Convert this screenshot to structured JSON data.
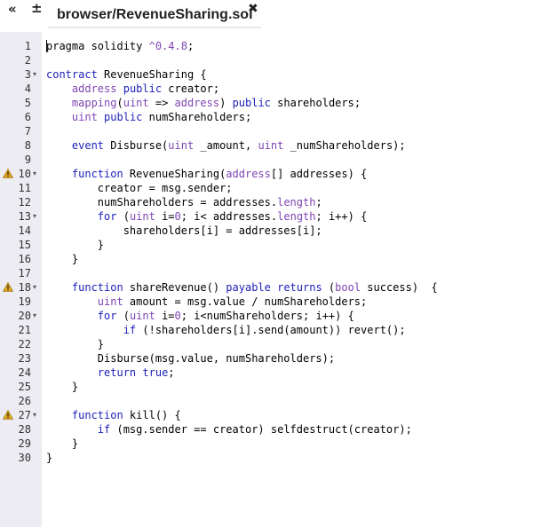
{
  "tabbar": {
    "nav_left": "«",
    "nav_right": "±",
    "tab_title": "browser/RevenueSharing.sol",
    "close_glyph": "✖"
  },
  "icons": {
    "warning_color": "#e3a418",
    "fold_marker": "▾"
  },
  "editor": {
    "lines": [
      {
        "n": "1",
        "fold": false,
        "warn": false,
        "tokens": [
          [
            "t",
            "pragma solidity "
          ],
          [
            "lit",
            "^0.4.8"
          ],
          [
            "t",
            ";"
          ]
        ]
      },
      {
        "n": "2",
        "fold": false,
        "warn": false,
        "tokens": []
      },
      {
        "n": "3",
        "fold": true,
        "warn": false,
        "tokens": [
          [
            "kw",
            "contract"
          ],
          [
            "t",
            " RevenueSharing {"
          ]
        ]
      },
      {
        "n": "4",
        "fold": false,
        "warn": false,
        "tokens": [
          [
            "t",
            "    "
          ],
          [
            "ty",
            "address"
          ],
          [
            "t",
            " "
          ],
          [
            "kw",
            "public"
          ],
          [
            "t",
            " creator;"
          ]
        ]
      },
      {
        "n": "5",
        "fold": false,
        "warn": false,
        "tokens": [
          [
            "t",
            "    "
          ],
          [
            "ty",
            "mapping"
          ],
          [
            "t",
            "("
          ],
          [
            "ty",
            "uint"
          ],
          [
            "t",
            " => "
          ],
          [
            "ty",
            "address"
          ],
          [
            "t",
            ") "
          ],
          [
            "kw",
            "public"
          ],
          [
            "t",
            " shareholders;"
          ]
        ]
      },
      {
        "n": "6",
        "fold": false,
        "warn": false,
        "tokens": [
          [
            "t",
            "    "
          ],
          [
            "ty",
            "uint"
          ],
          [
            "t",
            " "
          ],
          [
            "kw",
            "public"
          ],
          [
            "t",
            " numShareholders;"
          ]
        ]
      },
      {
        "n": "7",
        "fold": false,
        "warn": false,
        "tokens": []
      },
      {
        "n": "8",
        "fold": false,
        "warn": false,
        "tokens": [
          [
            "t",
            "    "
          ],
          [
            "kw",
            "event"
          ],
          [
            "t",
            " Disburse("
          ],
          [
            "ty",
            "uint"
          ],
          [
            "t",
            " _amount, "
          ],
          [
            "ty",
            "uint"
          ],
          [
            "t",
            " _numShareholders);"
          ]
        ]
      },
      {
        "n": "9",
        "fold": false,
        "warn": false,
        "tokens": []
      },
      {
        "n": "10",
        "fold": true,
        "warn": true,
        "tokens": [
          [
            "t",
            "    "
          ],
          [
            "kw",
            "function"
          ],
          [
            "t",
            " RevenueSharing("
          ],
          [
            "ty",
            "address"
          ],
          [
            "t",
            "[] addresses) {"
          ]
        ]
      },
      {
        "n": "11",
        "fold": false,
        "warn": false,
        "tokens": [
          [
            "t",
            "        creator = msg.sender;"
          ]
        ]
      },
      {
        "n": "12",
        "fold": false,
        "warn": false,
        "tokens": [
          [
            "t",
            "        numShareholders = addresses."
          ],
          [
            "ty",
            "length"
          ],
          [
            "t",
            ";"
          ]
        ]
      },
      {
        "n": "13",
        "fold": true,
        "warn": false,
        "tokens": [
          [
            "t",
            "        "
          ],
          [
            "kw",
            "for"
          ],
          [
            "t",
            " ("
          ],
          [
            "ty",
            "uint"
          ],
          [
            "t",
            " i="
          ],
          [
            "lit",
            "0"
          ],
          [
            "t",
            "; i< addresses."
          ],
          [
            "ty",
            "length"
          ],
          [
            "t",
            "; i++) {"
          ]
        ]
      },
      {
        "n": "14",
        "fold": false,
        "warn": false,
        "tokens": [
          [
            "t",
            "            shareholders[i] = addresses[i];"
          ]
        ]
      },
      {
        "n": "15",
        "fold": false,
        "warn": false,
        "tokens": [
          [
            "t",
            "        }"
          ]
        ]
      },
      {
        "n": "16",
        "fold": false,
        "warn": false,
        "tokens": [
          [
            "t",
            "    }"
          ]
        ]
      },
      {
        "n": "17",
        "fold": false,
        "warn": false,
        "tokens": []
      },
      {
        "n": "18",
        "fold": true,
        "warn": true,
        "tokens": [
          [
            "t",
            "    "
          ],
          [
            "kw",
            "function"
          ],
          [
            "t",
            " shareRevenue() "
          ],
          [
            "kw",
            "payable"
          ],
          [
            "t",
            " "
          ],
          [
            "kw",
            "returns"
          ],
          [
            "t",
            " ("
          ],
          [
            "ty",
            "bool"
          ],
          [
            "t",
            " success)  {"
          ]
        ]
      },
      {
        "n": "19",
        "fold": false,
        "warn": false,
        "tokens": [
          [
            "t",
            "        "
          ],
          [
            "ty",
            "uint"
          ],
          [
            "t",
            " amount = msg.value / numShareholders;"
          ]
        ]
      },
      {
        "n": "20",
        "fold": true,
        "warn": false,
        "tokens": [
          [
            "t",
            "        "
          ],
          [
            "kw",
            "for"
          ],
          [
            "t",
            " ("
          ],
          [
            "ty",
            "uint"
          ],
          [
            "t",
            " i="
          ],
          [
            "lit",
            "0"
          ],
          [
            "t",
            "; i<numShareholders; i++) {"
          ]
        ]
      },
      {
        "n": "21",
        "fold": false,
        "warn": false,
        "tokens": [
          [
            "t",
            "            "
          ],
          [
            "kw",
            "if"
          ],
          [
            "t",
            " (!shareholders[i].send(amount)) revert();"
          ]
        ]
      },
      {
        "n": "22",
        "fold": false,
        "warn": false,
        "tokens": [
          [
            "t",
            "        }"
          ]
        ]
      },
      {
        "n": "23",
        "fold": false,
        "warn": false,
        "tokens": [
          [
            "t",
            "        Disburse(msg.value, numShareholders);"
          ]
        ]
      },
      {
        "n": "24",
        "fold": false,
        "warn": false,
        "tokens": [
          [
            "t",
            "        "
          ],
          [
            "kw",
            "return"
          ],
          [
            "t",
            " "
          ],
          [
            "kw",
            "true"
          ],
          [
            "t",
            ";"
          ]
        ]
      },
      {
        "n": "25",
        "fold": false,
        "warn": false,
        "tokens": [
          [
            "t",
            "    }"
          ]
        ]
      },
      {
        "n": "26",
        "fold": false,
        "warn": false,
        "tokens": []
      },
      {
        "n": "27",
        "fold": true,
        "warn": true,
        "tokens": [
          [
            "t",
            "    "
          ],
          [
            "kw",
            "function"
          ],
          [
            "t",
            " kill() {"
          ]
        ]
      },
      {
        "n": "28",
        "fold": false,
        "warn": false,
        "tokens": [
          [
            "t",
            "        "
          ],
          [
            "kw",
            "if"
          ],
          [
            "t",
            " (msg.sender == creator) selfdestruct(creator);"
          ]
        ]
      },
      {
        "n": "29",
        "fold": false,
        "warn": false,
        "tokens": [
          [
            "t",
            "    }"
          ]
        ]
      },
      {
        "n": "30",
        "fold": false,
        "warn": false,
        "tokens": [
          [
            "t",
            "}"
          ]
        ]
      }
    ]
  }
}
